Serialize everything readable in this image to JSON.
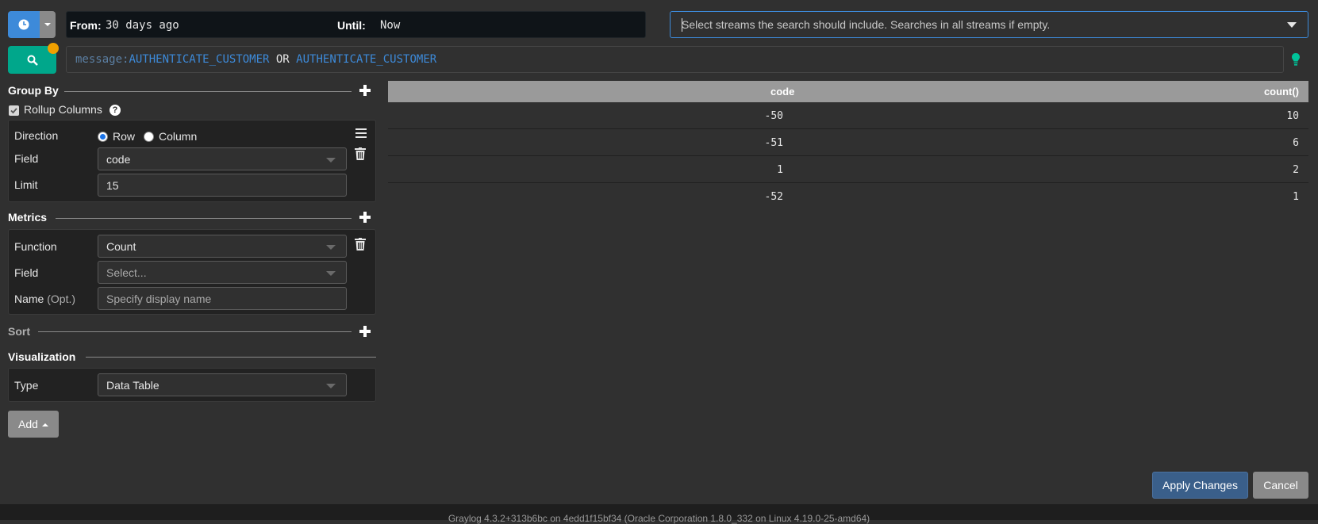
{
  "time_range": {
    "from_label": "From:",
    "from_value": "30 days ago",
    "until_label": "Until:",
    "until_value": "Now"
  },
  "streams": {
    "placeholder": "Select streams the search should include. Searches in all streams if empty."
  },
  "query": {
    "key": "message:",
    "term1": "AUTHENTICATE_CUSTOMER",
    "op": " OR ",
    "term2": "AUTHENTICATE_CUSTOMER"
  },
  "group_by": {
    "title": "Group By",
    "rollup_label": "Rollup Columns",
    "rollup_checked": true,
    "direction_label": "Direction",
    "direction_row": "Row",
    "direction_column": "Column",
    "direction_selected": "Row",
    "field_label": "Field",
    "field_value": "code",
    "limit_label": "Limit",
    "limit_value": "15"
  },
  "metrics": {
    "title": "Metrics",
    "function_label": "Function",
    "function_value": "Count",
    "field_label": "Field",
    "field_placeholder": "Select...",
    "name_label": "Name",
    "name_opt": "(Opt.)",
    "name_placeholder": "Specify display name"
  },
  "sort": {
    "title": "Sort"
  },
  "visualization": {
    "title": "Visualization",
    "type_label": "Type",
    "type_value": "Data Table"
  },
  "add_button": "Add",
  "table": {
    "headers": [
      "code",
      "count()"
    ],
    "rows": [
      [
        "-50",
        "10"
      ],
      [
        "-51",
        "6"
      ],
      [
        "1",
        "2"
      ],
      [
        "-52",
        "1"
      ]
    ]
  },
  "apply_button": "Apply Changes",
  "cancel_button": "Cancel",
  "footer": "Graylog 4.3.2+313b6bc on 4edd1f15bf34 (Oracle Corporation 1.8.0_332 on Linux 4.19.0-25-amd64)",
  "colors": {
    "accent_blue": "#3d8ad9",
    "search_green": "#00a78b",
    "dirty_orange": "#f0a000"
  },
  "icons": [
    "clock-icon",
    "search-icon",
    "lightbulb-icon",
    "hamburger-icon",
    "trash-icon",
    "plus-icon",
    "question-icon"
  ]
}
